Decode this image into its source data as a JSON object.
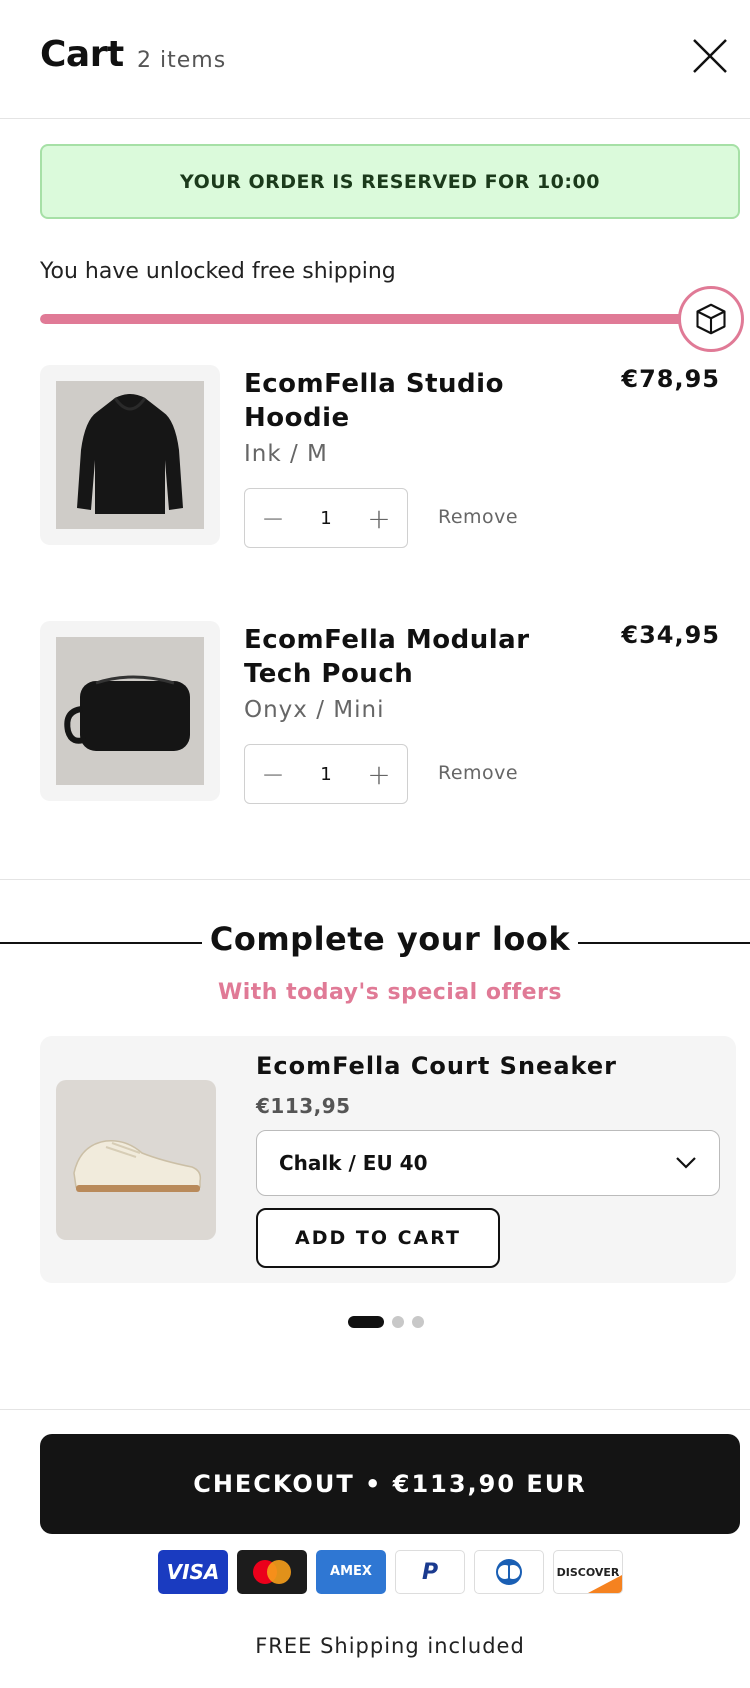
{
  "header": {
    "title": "Cart",
    "count": "2 items"
  },
  "reservation": {
    "text": "YOUR ORDER IS RESERVED FOR 10:00"
  },
  "shipping": {
    "text": "You have unlocked free shipping",
    "progress_fraction": 1.0,
    "accent": "#e07a96"
  },
  "items": [
    {
      "name": "EcomFella Studio Hoodie",
      "variant": "Ink / M",
      "price": "€78,95",
      "quantity": "1",
      "remove_label": "Remove"
    },
    {
      "name": "EcomFella Modular Tech Pouch",
      "variant": "Onyx / Mini",
      "price": "€34,95",
      "quantity": "1",
      "remove_label": "Remove"
    }
  ],
  "upsell": {
    "title": "Complete your look",
    "subtitle": "With today's special offers",
    "product": {
      "name": "EcomFella Court Sneaker",
      "price": "€113,95",
      "option": "Chalk / EU 40",
      "add_label": "ADD TO CART"
    },
    "pagination": {
      "current": 1,
      "total": 3
    }
  },
  "checkout": {
    "label": "CHECKOUT • €113,90 EUR"
  },
  "payment_methods": [
    {
      "name": "visa-icon",
      "text": "VISA"
    },
    {
      "name": "mastercard-icon",
      "text": ""
    },
    {
      "name": "amex-icon",
      "text": "AMEX"
    },
    {
      "name": "paypal-icon",
      "text": "P"
    },
    {
      "name": "diners-club-icon",
      "text": ""
    },
    {
      "name": "discover-icon",
      "text": "DISCOVER"
    }
  ],
  "footer": {
    "note": "FREE Shipping included"
  }
}
